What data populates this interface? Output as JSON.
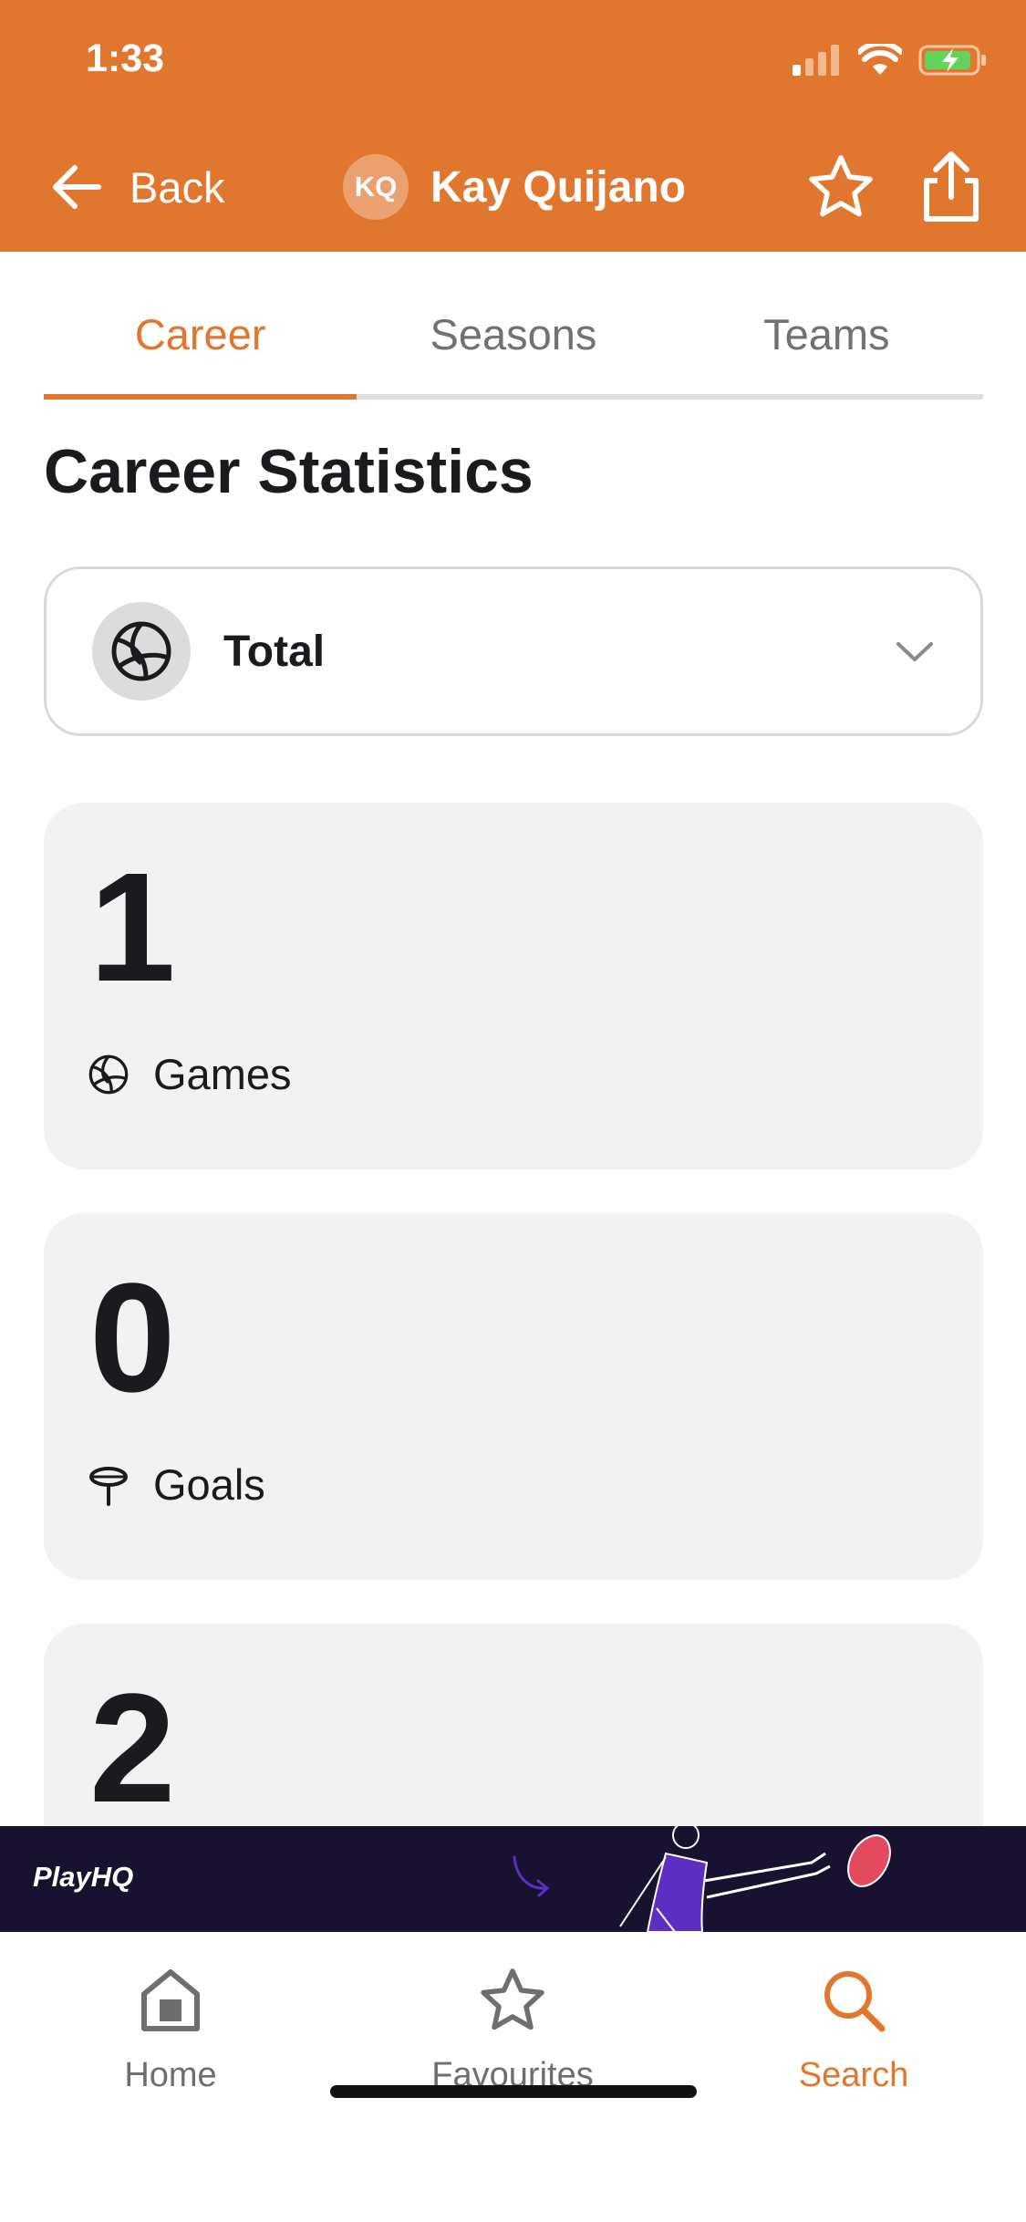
{
  "status_bar": {
    "time": "1:33"
  },
  "header": {
    "back_label": "Back",
    "avatar_initials": "KQ",
    "player_name": "Kay Quijano",
    "background_color": "#e1762e"
  },
  "tabs": [
    {
      "label": "Career",
      "active": true
    },
    {
      "label": "Seasons",
      "active": false
    },
    {
      "label": "Teams",
      "active": false
    }
  ],
  "section_title": "Career Statistics",
  "filter": {
    "selected": "Total",
    "icon": "netball-icon"
  },
  "stats": [
    {
      "value": "1",
      "label": "Games",
      "icon": "netball-icon"
    },
    {
      "value": "0",
      "label": "Goals",
      "icon": "goal-post-icon"
    },
    {
      "value": "2",
      "label": "",
      "icon": ""
    }
  ],
  "banner": {
    "logo_text": "PlayHQ"
  },
  "bottom_nav": [
    {
      "label": "Home",
      "icon": "home-icon",
      "active": false
    },
    {
      "label": "Favourites",
      "icon": "star-icon",
      "active": false
    },
    {
      "label": "Search",
      "icon": "search-icon",
      "active": true
    }
  ],
  "colors": {
    "accent": "#e1762e",
    "banner_bg": "#18112f",
    "card_bg": "#f2f2f2"
  }
}
